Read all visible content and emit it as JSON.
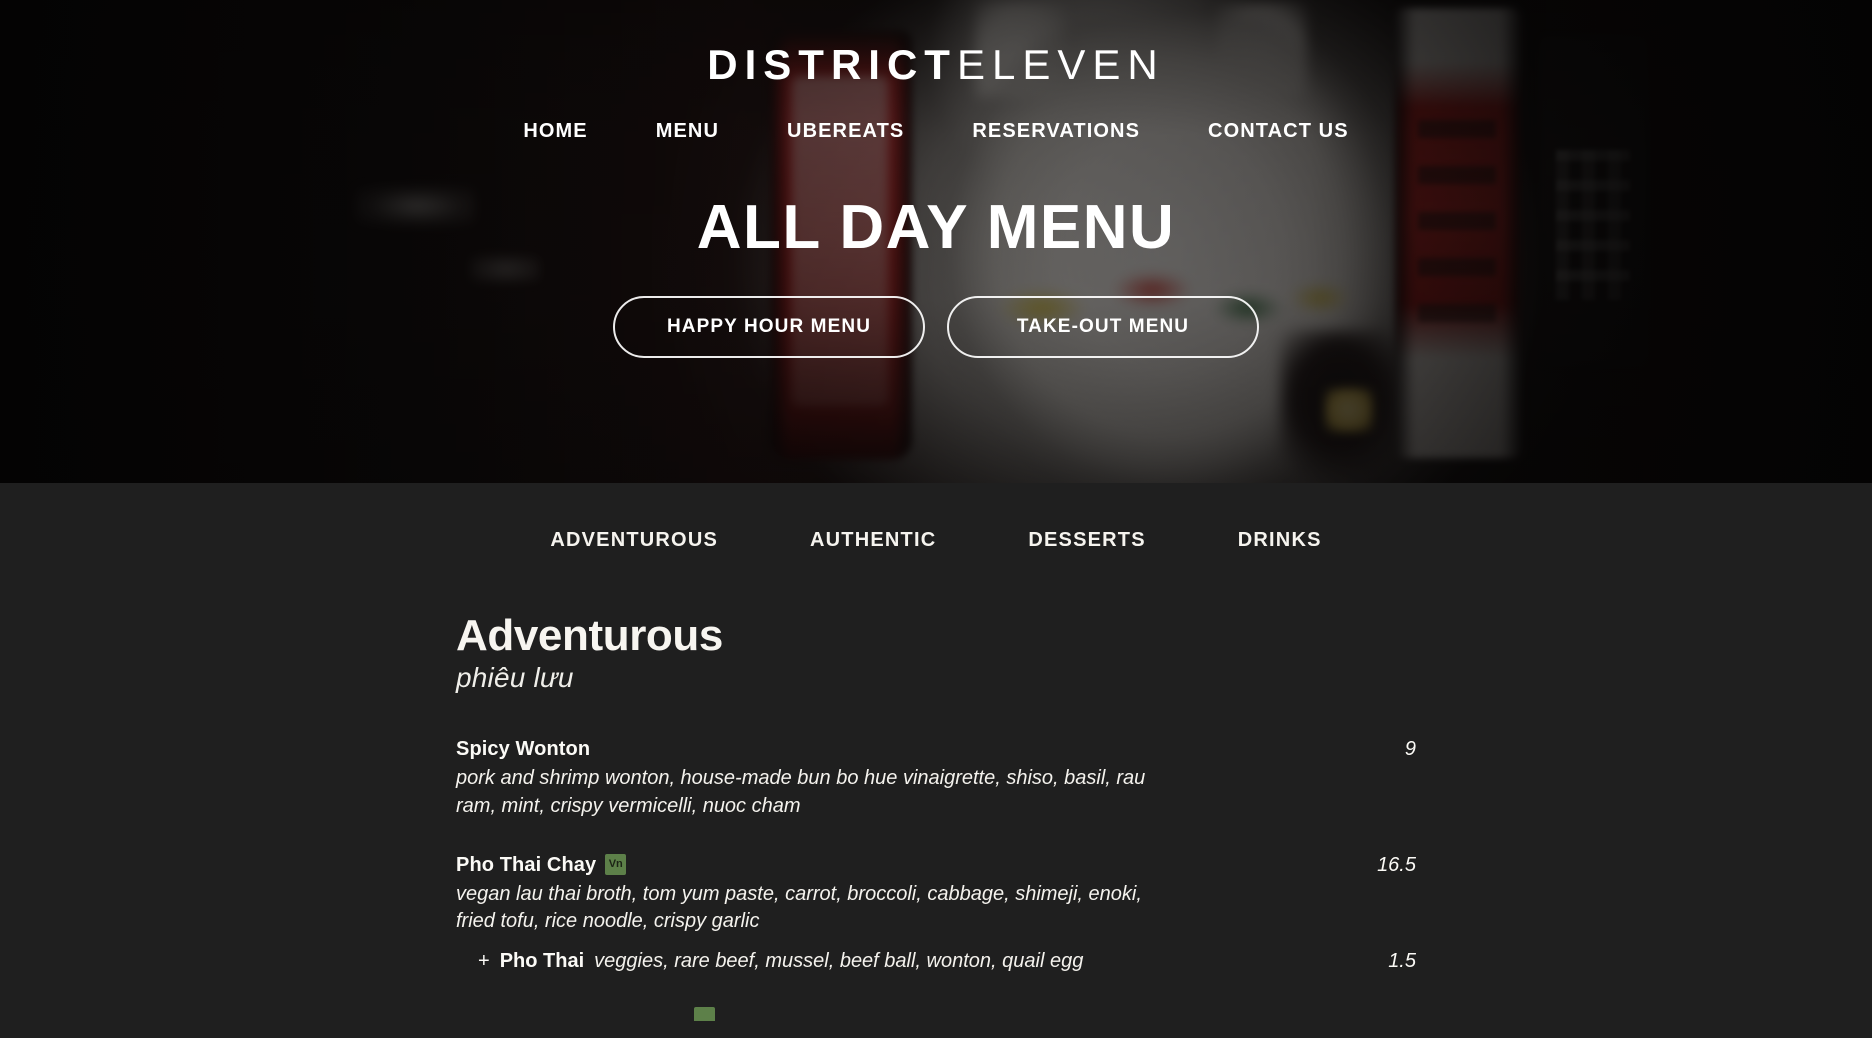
{
  "site": {
    "brand_strong": "DISTRICT",
    "brand_light": "ELEVEN"
  },
  "nav": {
    "items": [
      {
        "label": "HOME"
      },
      {
        "label": "MENU"
      },
      {
        "label": "UBEREATS"
      },
      {
        "label": "RESERVATIONS"
      },
      {
        "label": "CONTACT US"
      }
    ]
  },
  "hero": {
    "title": "ALL DAY MENU",
    "buttons": [
      {
        "label": "HAPPY HOUR MENU"
      },
      {
        "label": "TAKE-OUT MENU"
      }
    ],
    "background_description": "dark blurred photo of a white maneki-neko lucky cat with red and white japanese lanterns and a black telephone"
  },
  "menu_tabs": [
    {
      "label": "ADVENTUROUS",
      "active": true
    },
    {
      "label": "AUTHENTIC",
      "active": false
    },
    {
      "label": "DESSERTS",
      "active": false
    },
    {
      "label": "DRINKS",
      "active": false
    }
  ],
  "section": {
    "title": "Adventurous",
    "subtitle": "phiêu lưu"
  },
  "items": [
    {
      "name": "Spicy Wonton",
      "badge": null,
      "price": "9",
      "description": "pork and shrimp wonton, house-made bun bo hue vinaigrette, shiso, basil, rau ram, mint, crispy vermicelli, nuoc cham",
      "addon": null
    },
    {
      "name": "Pho Thai Chay",
      "badge": "Vn",
      "price": "16.5",
      "description": "vegan lau thai broth, tom yum paste, carrot, broccoli, cabbage, shimeji, enoki, fried tofu, rice noodle, crispy garlic",
      "addon": {
        "plus": "+",
        "name": "Pho Thai",
        "description": "veggies, rare beef, mussel, beef ball, wonton, quail egg",
        "price": "1.5"
      }
    }
  ],
  "colors": {
    "page_background": "#1f1f1f",
    "text_primary": "#fbfaf6",
    "badge_green": "#5d8049",
    "badge_text": "#1c2416"
  }
}
